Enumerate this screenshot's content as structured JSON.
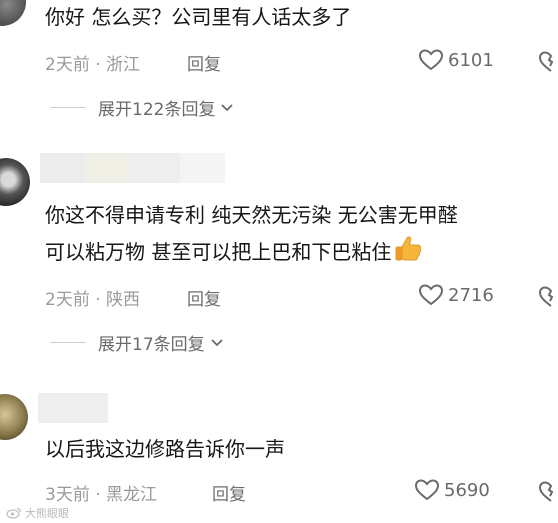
{
  "comments": [
    {
      "text_lines": [
        "你好 怎么买？公司里有人话太多了"
      ],
      "time": "2天前",
      "location": "浙江",
      "reply_label": "回复",
      "likes": "6101",
      "expand_label": "展开122条回复"
    },
    {
      "text_lines": [
        "你这不得申请专利 纯天然无污染 无公害无甲醛",
        "可以粘万物 甚至可以把上巴和下巴粘住"
      ],
      "time": "2天前",
      "location": "陕西",
      "reply_label": "回复",
      "likes": "2716",
      "expand_label": "展开17条回复"
    },
    {
      "text_lines": [
        "以后我这边修路告诉你一声"
      ],
      "time": "3天前",
      "location": "黑龙江",
      "reply_label": "回复",
      "likes": "5690"
    }
  ],
  "separator": "·",
  "watermark": "大熊眼眼",
  "colors": {
    "text": "#161616",
    "meta": "#9a9a9a",
    "accent_icon": "#6a6a6a"
  }
}
